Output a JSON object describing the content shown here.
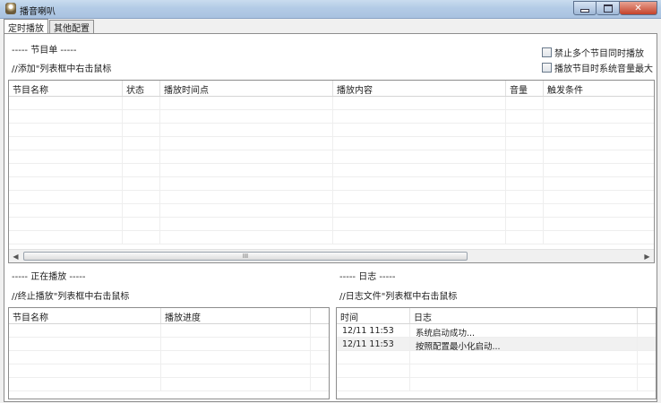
{
  "window": {
    "title": "播音喇叭",
    "minimize": "",
    "maximize": "",
    "close": "✕"
  },
  "tabs": [
    {
      "label": "定时播放",
      "active": true
    },
    {
      "label": "其他配置",
      "active": false
    }
  ],
  "program_section": {
    "heading": "----- 节目单 -----",
    "hint": "//添加\"列表框中右击鼠标",
    "options": [
      {
        "label": "禁止多个节目同时播放",
        "checked": false
      },
      {
        "label": "播放节目时系统音量最大",
        "checked": false
      }
    ],
    "columns": [
      "节目名称",
      "状态",
      "播放时间点",
      "播放内容",
      "音量",
      "触发条件"
    ],
    "rows": [],
    "scroll_thumb": "III"
  },
  "playing_section": {
    "heading": "----- 正在播放 -----",
    "hint": "//终止播放\"列表框中右击鼠标",
    "columns": [
      "节目名称",
      "播放进度"
    ],
    "rows": []
  },
  "log_section": {
    "heading": "----- 日志 -----",
    "hint": "//日志文件\"列表框中右击鼠标",
    "columns": [
      "时间",
      "日志"
    ],
    "rows": [
      {
        "time": "12/11 11:53",
        "message": "系统启动成功..."
      },
      {
        "time": "12/11 11:53",
        "message": "按照配置最小化启动..."
      }
    ]
  }
}
